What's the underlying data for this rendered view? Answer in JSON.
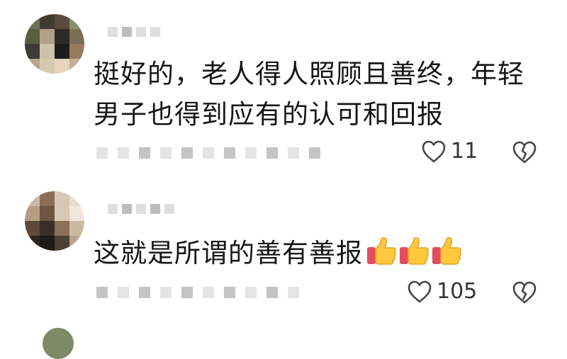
{
  "comments": [
    {
      "text": "挺好的，老人得人照顾且善终，年轻男子也得到应有的认可和回报",
      "line1": "挺好的，老人得人照顾且善终，年轻",
      "line2": "男子也得到应有的认可和回报",
      "likes": "11"
    },
    {
      "text": "这就是所谓的善有善报",
      "likes": "105"
    }
  ],
  "icons": {
    "like": "heart-outline-icon",
    "dislike": "broken-heart-icon",
    "emoji": "thumbs-up-emoji-icon"
  }
}
